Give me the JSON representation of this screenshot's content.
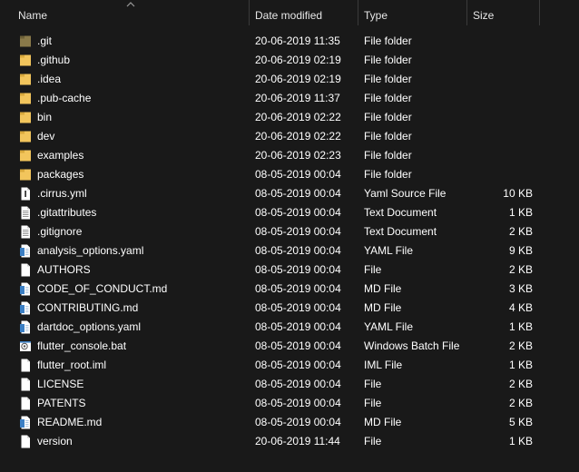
{
  "columns": {
    "name": "Name",
    "date": "Date modified",
    "type": "Type",
    "size": "Size"
  },
  "files": [
    {
      "name": ".git",
      "date": "20-06-2019 11:35",
      "type": "File folder",
      "size": "",
      "icon": "folder-icon"
    },
    {
      "name": ".github",
      "date": "20-06-2019 02:19",
      "type": "File folder",
      "size": "",
      "icon": "folder-icon"
    },
    {
      "name": ".idea",
      "date": "20-06-2019 02:19",
      "type": "File folder",
      "size": "",
      "icon": "folder-icon"
    },
    {
      "name": ".pub-cache",
      "date": "20-06-2019 11:37",
      "type": "File folder",
      "size": "",
      "icon": "folder-icon"
    },
    {
      "name": "bin",
      "date": "20-06-2019 02:22",
      "type": "File folder",
      "size": "",
      "icon": "folder-icon"
    },
    {
      "name": "dev",
      "date": "20-06-2019 02:22",
      "type": "File folder",
      "size": "",
      "icon": "folder-icon"
    },
    {
      "name": "examples",
      "date": "20-06-2019 02:23",
      "type": "File folder",
      "size": "",
      "icon": "folder-icon"
    },
    {
      "name": "packages",
      "date": "08-05-2019 00:04",
      "type": "File folder",
      "size": "",
      "icon": "folder-icon"
    },
    {
      "name": ".cirrus.yml",
      "date": "08-05-2019 00:04",
      "type": "Yaml Source File",
      "size": "10 KB",
      "icon": "yaml-file-icon"
    },
    {
      "name": ".gitattributes",
      "date": "08-05-2019 00:04",
      "type": "Text Document",
      "size": "1 KB",
      "icon": "text-file-icon"
    },
    {
      "name": ".gitignore",
      "date": "08-05-2019 00:04",
      "type": "Text Document",
      "size": "2 KB",
      "icon": "text-file-icon"
    },
    {
      "name": "analysis_options.yaml",
      "date": "08-05-2019 00:04",
      "type": "YAML File",
      "size": "9 KB",
      "icon": "code-file-icon"
    },
    {
      "name": "AUTHORS",
      "date": "08-05-2019 00:04",
      "type": "File",
      "size": "2 KB",
      "icon": "blank-file-icon"
    },
    {
      "name": "CODE_OF_CONDUCT.md",
      "date": "08-05-2019 00:04",
      "type": "MD File",
      "size": "3 KB",
      "icon": "code-file-icon"
    },
    {
      "name": "CONTRIBUTING.md",
      "date": "08-05-2019 00:04",
      "type": "MD File",
      "size": "4 KB",
      "icon": "code-file-icon"
    },
    {
      "name": "dartdoc_options.yaml",
      "date": "08-05-2019 00:04",
      "type": "YAML File",
      "size": "1 KB",
      "icon": "code-file-icon"
    },
    {
      "name": "flutter_console.bat",
      "date": "08-05-2019 00:04",
      "type": "Windows Batch File",
      "size": "2 KB",
      "icon": "batch-file-icon"
    },
    {
      "name": "flutter_root.iml",
      "date": "08-05-2019 00:04",
      "type": "IML File",
      "size": "1 KB",
      "icon": "blank-file-icon"
    },
    {
      "name": "LICENSE",
      "date": "08-05-2019 00:04",
      "type": "File",
      "size": "2 KB",
      "icon": "blank-file-icon"
    },
    {
      "name": "PATENTS",
      "date": "08-05-2019 00:04",
      "type": "File",
      "size": "2 KB",
      "icon": "blank-file-icon"
    },
    {
      "name": "README.md",
      "date": "08-05-2019 00:04",
      "type": "MD File",
      "size": "5 KB",
      "icon": "code-file-icon"
    },
    {
      "name": "version",
      "date": "20-06-2019 11:44",
      "type": "File",
      "size": "1 KB",
      "icon": "blank-file-icon"
    }
  ],
  "colors": {
    "background": "#191919",
    "folder": "#f2c55c",
    "folder_dark": "#8a7a4a",
    "text": "#ffffff"
  }
}
